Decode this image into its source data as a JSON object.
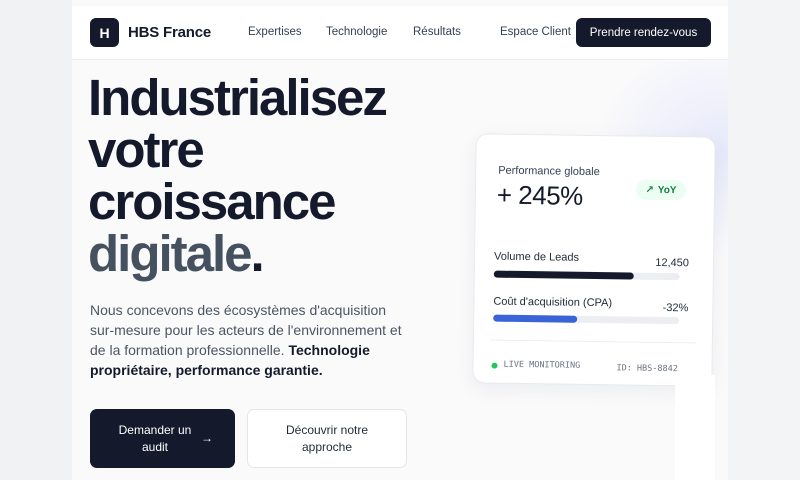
{
  "header": {
    "logo_letter": "H",
    "brand": "HBS France",
    "nav": [
      "Expertises",
      "Technologie",
      "Résultats"
    ],
    "client_link": "Espace Client",
    "cta": "Prendre rendez-vous"
  },
  "hero": {
    "lines": [
      "Industrialisez",
      "votre",
      "croissance",
      "digitale"
    ],
    "dot": ".",
    "description": "Nous concevons des écosystèmes d'acquisition sur-mesure pour les acteurs de l'environnement et de la formation professionnelle.",
    "description_strong": "Technologie propriétaire, performance garantie.",
    "primary_button": "Demander un audit",
    "primary_arrow": "→",
    "secondary_button": "Découvrir notre approche"
  },
  "card": {
    "label": "Performance globale",
    "big_value": "+ 245%",
    "badge_icon": "trend-up-icon",
    "badge_glyph": "↗",
    "badge": "YoY",
    "metrics": [
      {
        "label": "Volume de Leads",
        "value": "12,450",
        "fill_percent": 75,
        "color": "#141a2b"
      },
      {
        "label": "Coût d'acquisition (CPA)",
        "value": "-32%",
        "fill_percent": 45,
        "color": "#3b63d8"
      }
    ],
    "live": "LIVE MONITORING",
    "id": "ID: HBS-8842"
  }
}
